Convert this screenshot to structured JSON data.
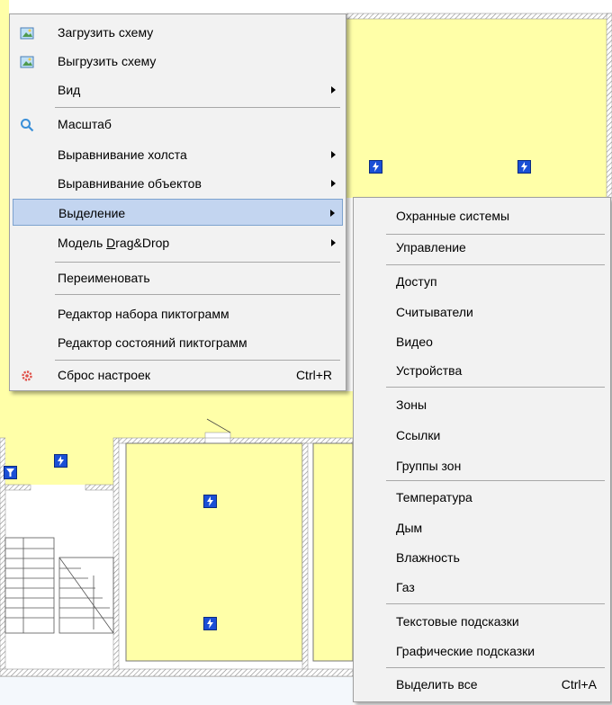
{
  "main_menu": {
    "items": [
      {
        "label": "Загрузить схему",
        "icon": "upload-image-icon"
      },
      {
        "label": "Выгрузить схему",
        "icon": "download-image-icon"
      },
      {
        "label": "Вид",
        "submenu": true
      },
      {
        "label": "Масштаб",
        "icon": "magnifier-icon"
      },
      {
        "label": "Выравнивание холста",
        "submenu": true
      },
      {
        "label": "Выравнивание объектов",
        "submenu": true
      },
      {
        "label": "Выделение",
        "submenu": true,
        "highlighted": true
      },
      {
        "label_prefix": "Модель ",
        "label_underlined": "D",
        "label_suffix": "rag&Drop",
        "submenu": true
      },
      {
        "label": "Переименовать"
      },
      {
        "label": "Редактор набора пиктограмм"
      },
      {
        "label": "Редактор состояний пиктограмм"
      },
      {
        "label": "Сброс настроек",
        "shortcut": "Ctrl+R",
        "icon": "gear-icon"
      }
    ]
  },
  "sub_menu": {
    "items": [
      {
        "label": "Охранные системы"
      },
      {
        "label": "Управление"
      },
      {
        "label": "Доступ"
      },
      {
        "label": "Считыватели"
      },
      {
        "label": "Видео"
      },
      {
        "label": "Устройства"
      },
      {
        "label": "Зоны"
      },
      {
        "label": "Ссылки"
      },
      {
        "label": "Группы зон"
      },
      {
        "label": "Температура"
      },
      {
        "label": "Дым"
      },
      {
        "label": "Влажность"
      },
      {
        "label": "Газ"
      },
      {
        "label": "Текстовые подсказки"
      },
      {
        "label": "Графические подсказки"
      },
      {
        "label": "Выделить все",
        "shortcut": "Ctrl+A"
      }
    ]
  },
  "colors": {
    "zone_fill": "#ffffa8",
    "highlight": "#c3d5f0",
    "sensor_blue": "#1a4fd6",
    "wall_hatch": "#9a9a9a"
  }
}
